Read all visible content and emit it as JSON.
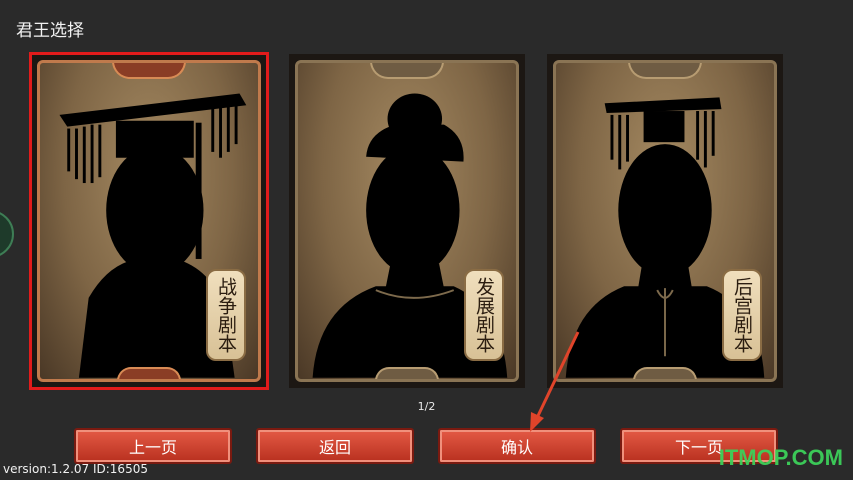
{
  "header": {
    "title": "君王选择"
  },
  "cards": [
    {
      "label": "战争剧本",
      "selected": true
    },
    {
      "label": "发展剧本",
      "selected": false
    },
    {
      "label": "后宫剧本",
      "selected": false
    }
  ],
  "pager": {
    "text": "1/2"
  },
  "buttons": {
    "prev": "上一页",
    "back": "返回",
    "confirm": "确认",
    "next": "下一页"
  },
  "footer": {
    "version": "version:1.2.07   ID:16505"
  },
  "watermark": {
    "text": "ITMOP.COM"
  },
  "colors": {
    "selected_outline": "#e21b1b",
    "button": "#d2452f",
    "watermark": "#3cd05a"
  }
}
